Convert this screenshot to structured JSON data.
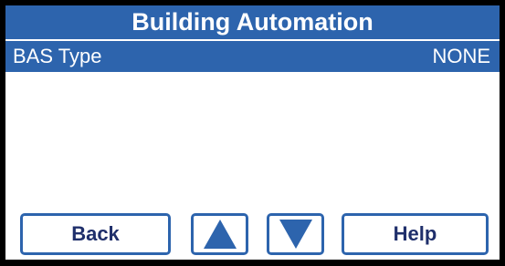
{
  "header": {
    "title": "Building Automation"
  },
  "selected_row": {
    "label": "BAS Type",
    "value": "NONE"
  },
  "buttons": {
    "back_label": "Back",
    "help_label": "Help",
    "up_icon": "up-arrow-icon",
    "down_icon": "down-arrow-icon"
  },
  "colors": {
    "accent": "#2d64ad",
    "button_text": "#1f2f6b",
    "bezel": "#000000",
    "background": "#ffffff"
  }
}
